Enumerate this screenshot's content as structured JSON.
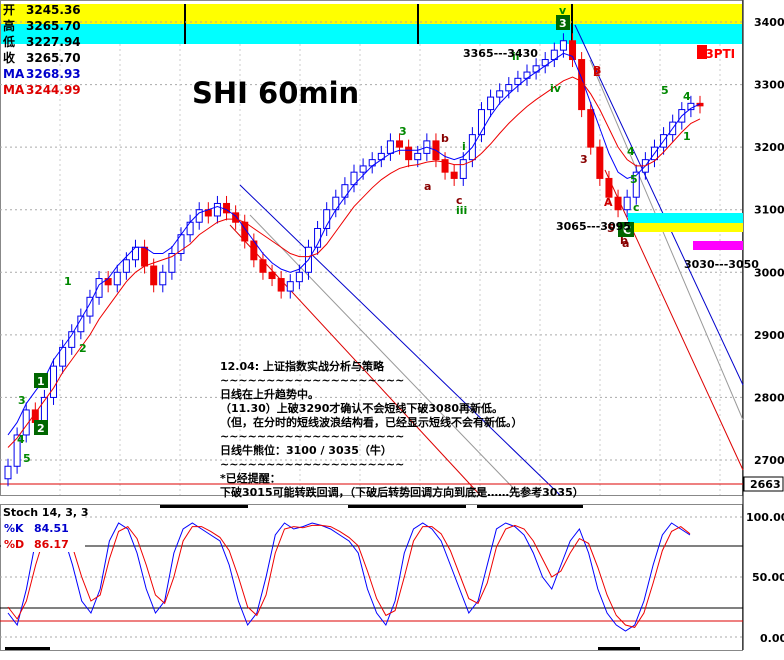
{
  "ohlc_box": {
    "rows": [
      {
        "label": "开",
        "value": "3245.36",
        "color": "#000000"
      },
      {
        "label": "高",
        "value": "3265.70",
        "color": "#000000"
      },
      {
        "label": "低",
        "value": "3227.94",
        "color": "#000000"
      },
      {
        "label": "收",
        "value": "3265.70",
        "color": "#000000"
      },
      {
        "label": "MA",
        "value": "3268.93",
        "color": "#0000cc"
      },
      {
        "label": "MA",
        "value": "3244.99",
        "color": "#dd0000"
      }
    ]
  },
  "title": "SHI 60min",
  "badge": "63PTI",
  "stoch": {
    "title": "Stoch 14, 3, 3",
    "k_label": "%K",
    "k_value": "84.51",
    "d_label": "%D",
    "d_value": "86.17",
    "axis_ticks": [
      "100.00",
      "50.00",
      "0.00"
    ]
  },
  "price_axis": {
    "ticks": [
      "3400",
      "3300",
      "3200",
      "3100",
      "3000",
      "2900",
      "2800",
      "2700"
    ],
    "current": "2663"
  },
  "annotations": {
    "range_high": "3365---3430",
    "range_mid": "3065---3095",
    "range_low": "3030---3050",
    "wave_labels": [
      "1",
      "2",
      "3",
      "4",
      "5",
      "1",
      "2",
      "3",
      "a",
      "b",
      "c",
      "i",
      "ii",
      "iii",
      "iv",
      "v",
      "3",
      "4",
      "5",
      "5",
      "4",
      "1",
      "2",
      "3",
      "4",
      "5",
      "a",
      "b",
      "c",
      "A",
      "B",
      "C"
    ]
  },
  "commentary": {
    "lines": [
      "12.04: 上证指数实战分析与策略",
      "~~~~~~~~~~~~~~~~~~~~",
      "日线在上升趋势中。",
      "（11.30）上破3290才确认不会短线下破3080再新低。",
      "（但，在分时的短线波浪结构看，已经显示短线不会有新低。）",
      "~~~~~~~~~~~~~~~~~~~~",
      "日线牛熊位：3100 / 3035（牛）",
      "~~~~~~~~~~~~~~~~~~~~",
      "*已经提醒：",
      "下破3015可能转跌回调，（下破后转势回调方向到底是……先参考3035）"
    ]
  },
  "colors": {
    "up": "#0000ee",
    "down": "#ee0000",
    "ma_fast": "#0000ff",
    "ma_slow": "#ee0000",
    "band_yellow": "#ffff00",
    "band_cyan": "#00ffff",
    "wave_green": "#008800",
    "badge_red": "#ff0000"
  },
  "chart_data": {
    "type": "candlestick",
    "title": "SHI 60min",
    "ylim": [
      2663,
      3440
    ],
    "y_ticks": [
      2700,
      2800,
      2900,
      3000,
      3100,
      3200,
      3300,
      3400
    ],
    "grid": true,
    "candles_close": [
      2690,
      2740,
      2780,
      2760,
      2800,
      2850,
      2880,
      2905,
      2930,
      2960,
      2990,
      2980,
      3000,
      3020,
      3040,
      3010,
      2980,
      3000,
      3030,
      3060,
      3080,
      3100,
      3090,
      3110,
      3095,
      3080,
      3050,
      3020,
      3000,
      2990,
      2970,
      2985,
      3000,
      3040,
      3070,
      3100,
      3120,
      3140,
      3160,
      3170,
      3180,
      3190,
      3210,
      3200,
      3180,
      3190,
      3210,
      3180,
      3160,
      3150,
      3180,
      3220,
      3260,
      3280,
      3290,
      3300,
      3310,
      3320,
      3330,
      3340,
      3355,
      3370,
      3340,
      3260,
      3200,
      3150,
      3120,
      3100,
      3120,
      3160,
      3180,
      3200,
      3220,
      3240,
      3260,
      3270,
      3266
    ],
    "ma_fast": [
      2740,
      2760,
      2790,
      2810,
      2830,
      2860,
      2880,
      2900,
      2925,
      2950,
      2980,
      2990,
      3010,
      3025,
      3040,
      3040,
      3030,
      3030,
      3040,
      3060,
      3080,
      3095,
      3100,
      3105,
      3100,
      3090,
      3070,
      3050,
      3030,
      3015,
      3005,
      3000,
      3005,
      3020,
      3045,
      3075,
      3100,
      3120,
      3140,
      3155,
      3170,
      3180,
      3190,
      3195,
      3195,
      3195,
      3200,
      3195,
      3185,
      3180,
      3185,
      3200,
      3225,
      3250,
      3270,
      3285,
      3298,
      3310,
      3320,
      3330,
      3340,
      3350,
      3345,
      3310,
      3270,
      3230,
      3190,
      3160,
      3150,
      3155,
      3170,
      3190,
      3210,
      3230,
      3250,
      3262,
      3269
    ],
    "ma_slow": [
      2720,
      2735,
      2755,
      2775,
      2795,
      2815,
      2840,
      2860,
      2880,
      2900,
      2925,
      2945,
      2965,
      2985,
      3000,
      3010,
      3015,
      3020,
      3025,
      3035,
      3045,
      3060,
      3070,
      3080,
      3085,
      3085,
      3080,
      3070,
      3060,
      3050,
      3040,
      3030,
      3025,
      3025,
      3030,
      3045,
      3065,
      3085,
      3105,
      3120,
      3135,
      3148,
      3158,
      3166,
      3170,
      3172,
      3176,
      3178,
      3176,
      3172,
      3172,
      3178,
      3190,
      3205,
      3222,
      3238,
      3252,
      3265,
      3276,
      3286,
      3296,
      3306,
      3312,
      3305,
      3285,
      3260,
      3230,
      3200,
      3180,
      3170,
      3170,
      3178,
      3192,
      3208,
      3224,
      3238,
      3245
    ],
    "stoch_k": [
      20,
      10,
      40,
      80,
      90,
      95,
      85,
      60,
      30,
      20,
      40,
      80,
      95,
      90,
      70,
      40,
      20,
      30,
      70,
      90,
      95,
      90,
      85,
      80,
      60,
      30,
      10,
      20,
      50,
      85,
      95,
      90,
      92,
      95,
      93,
      90,
      85,
      80,
      70,
      40,
      20,
      10,
      30,
      70,
      90,
      95,
      90,
      80,
      60,
      40,
      20,
      30,
      60,
      90,
      95,
      92,
      85,
      70,
      50,
      40,
      60,
      80,
      90,
      70,
      40,
      20,
      10,
      5,
      10,
      30,
      60,
      85,
      95,
      90,
      85
    ],
    "stoch_d": [
      25,
      15,
      30,
      60,
      85,
      92,
      90,
      75,
      50,
      30,
      35,
      65,
      88,
      92,
      82,
      60,
      35,
      28,
      50,
      80,
      92,
      92,
      88,
      83,
      72,
      50,
      25,
      18,
      35,
      70,
      90,
      92,
      91,
      93,
      93,
      92,
      88,
      83,
      76,
      55,
      32,
      18,
      22,
      50,
      80,
      92,
      92,
      86,
      72,
      52,
      32,
      28,
      45,
      75,
      90,
      93,
      90,
      80,
      65,
      50,
      55,
      70,
      82,
      78,
      58,
      35,
      18,
      10,
      8,
      20,
      45,
      72,
      88,
      92,
      86
    ]
  }
}
